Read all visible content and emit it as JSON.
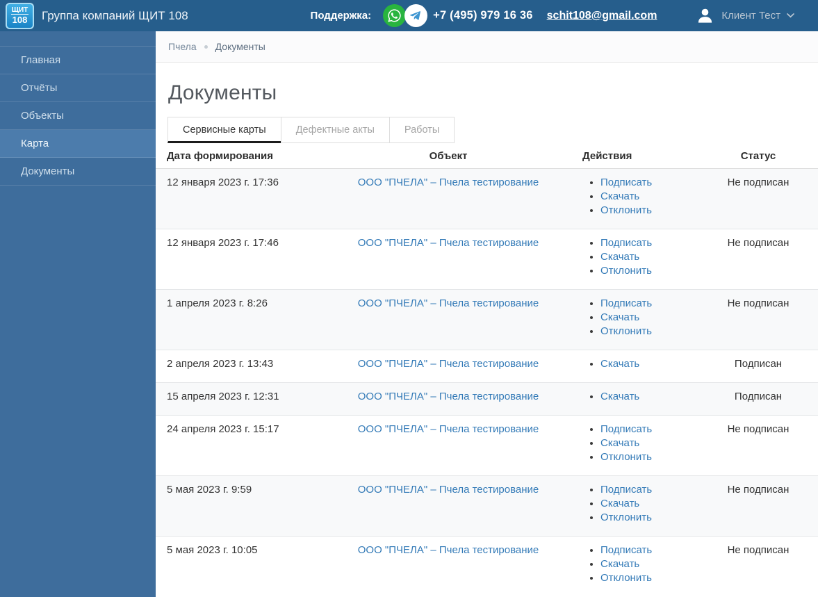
{
  "header": {
    "logo": {
      "line1": "ЩИТ",
      "line2": "108"
    },
    "company_name": "Группа компаний ЩИТ 108",
    "support_label": "Поддержка:",
    "phone": "+7 (495) 979 16 36",
    "email": "schit108@gmail.com",
    "user_name": "Клиент Тест",
    "icons": {
      "whatsapp": "whatsapp-icon",
      "telegram": "telegram-icon",
      "user": "user-icon",
      "chevron": "chevron-down-icon"
    }
  },
  "sidebar": {
    "items": [
      {
        "label": "Главная",
        "active": false
      },
      {
        "label": "Отчёты",
        "active": false
      },
      {
        "label": "Объекты",
        "active": false
      },
      {
        "label": "Карта",
        "active": true
      },
      {
        "label": "Документы",
        "active": false
      }
    ]
  },
  "breadcrumb": {
    "items": [
      "Пчела",
      "Документы"
    ]
  },
  "page": {
    "title": "Документы"
  },
  "tabs": [
    {
      "label": "Сервисные карты",
      "active": true
    },
    {
      "label": "Дефектные акты",
      "active": false
    },
    {
      "label": "Работы",
      "active": false
    }
  ],
  "table": {
    "columns": [
      "Дата формирования",
      "Объект",
      "Действия",
      "Статус"
    ],
    "rows": [
      {
        "date": "12 января 2023 г. 17:36",
        "object": "ООО \"ПЧЕЛА\" – Пчела тестирование",
        "actions": [
          "Подписать",
          "Скачать",
          "Отклонить"
        ],
        "status": "Не подписан"
      },
      {
        "date": "12 января 2023 г. 17:46",
        "object": "ООО \"ПЧЕЛА\" – Пчела тестирование",
        "actions": [
          "Подписать",
          "Скачать",
          "Отклонить"
        ],
        "status": "Не подписан"
      },
      {
        "date": "1 апреля 2023 г. 8:26",
        "object": "ООО \"ПЧЕЛА\" – Пчела тестирование",
        "actions": [
          "Подписать",
          "Скачать",
          "Отклонить"
        ],
        "status": "Не подписан"
      },
      {
        "date": "2 апреля 2023 г. 13:43",
        "object": "ООО \"ПЧЕЛА\" – Пчела тестирование",
        "actions": [
          "Скачать"
        ],
        "status": "Подписан"
      },
      {
        "date": "15 апреля 2023 г. 12:31",
        "object": "ООО \"ПЧЕЛА\" – Пчела тестирование",
        "actions": [
          "Скачать"
        ],
        "status": "Подписан"
      },
      {
        "date": "24 апреля 2023 г. 15:17",
        "object": "ООО \"ПЧЕЛА\" – Пчела тестирование",
        "actions": [
          "Подписать",
          "Скачать",
          "Отклонить"
        ],
        "status": "Не подписан"
      },
      {
        "date": "5 мая 2023 г. 9:59",
        "object": "ООО \"ПЧЕЛА\" – Пчела тестирование",
        "actions": [
          "Подписать",
          "Скачать",
          "Отклонить"
        ],
        "status": "Не подписан"
      },
      {
        "date": "5 мая 2023 г. 10:05",
        "object": "ООО \"ПЧЕЛА\" – Пчела тестирование",
        "actions": [
          "Подписать",
          "Скачать",
          "Отклонить"
        ],
        "status": "Не подписан"
      }
    ]
  },
  "colors": {
    "topbar_bg": "#265e8c",
    "sidebar_bg": "#3e6d9c",
    "sidebar_active_bg": "#4c7cac",
    "link_blue": "#337ab7",
    "whatsapp_green": "#29b43f",
    "telegram_blue": "#3f96d1",
    "row_stripe": "#f8f9fa"
  }
}
